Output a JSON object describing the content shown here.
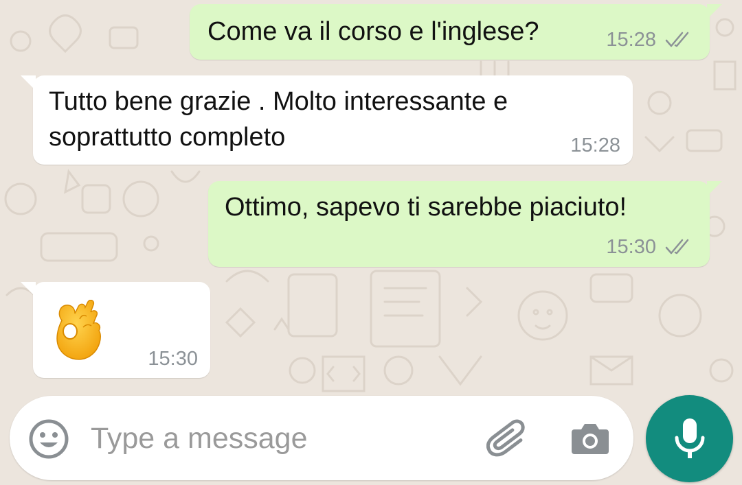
{
  "messages": [
    {
      "direction": "outgoing",
      "text": "Come va il corso e l'inglese?",
      "time": "15:28",
      "status_icon": "double-check-icon"
    },
    {
      "direction": "incoming",
      "lines": [
        "Tutto bene grazie . Molto interessante e",
        "soprattutto completo"
      ],
      "time": "15:28"
    },
    {
      "direction": "outgoing",
      "text": "Ottimo, sapevo ti sarebbe piaciuto!",
      "time": "15:30",
      "status_icon": "double-check-icon"
    },
    {
      "direction": "incoming",
      "emoji": "👌",
      "emoji_name": "ok-hand-emoji",
      "time": "15:30"
    }
  ],
  "composer": {
    "placeholder": "Type a message",
    "value": "",
    "icons": [
      "emoji-icon",
      "paperclip-icon",
      "camera-icon",
      "microphone-icon"
    ]
  },
  "colors": {
    "wallpaper": "#ece5dd",
    "outgoing_bubble": "#dcf8c6",
    "incoming_bubble": "#ffffff",
    "meta_text": "#8b9196",
    "mic_button": "#128c7e"
  }
}
